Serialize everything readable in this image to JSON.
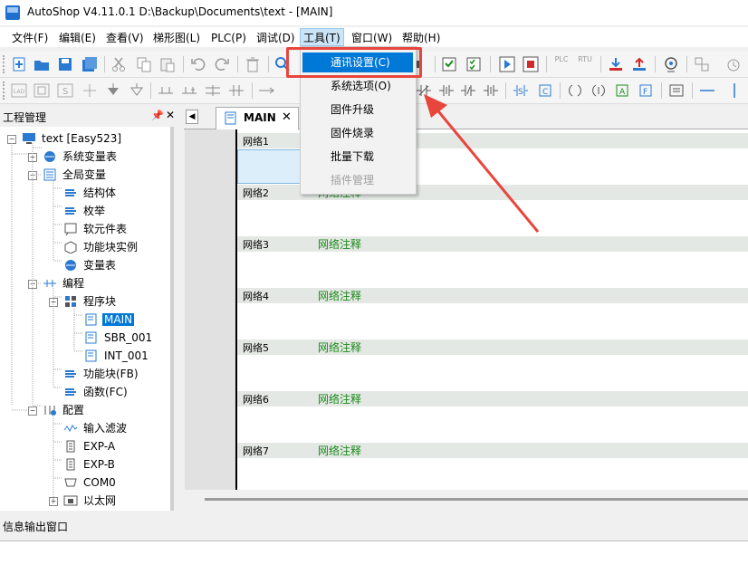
{
  "window": {
    "title": "AutoShop V4.11.0.1  D:\\Backup\\Documents\\text - [MAIN]"
  },
  "menubar": [
    {
      "label": "文件(F)"
    },
    {
      "label": "编辑(E)"
    },
    {
      "label": "查看(V)"
    },
    {
      "label": "梯形图(L)"
    },
    {
      "label": "PLC(P)"
    },
    {
      "label": "调试(D)"
    },
    {
      "label": "工具(T)"
    },
    {
      "label": "窗口(W)"
    },
    {
      "label": "帮助(H)"
    }
  ],
  "tools_menu": {
    "items": [
      {
        "label": "通讯设置(C)",
        "highlighted": true
      },
      {
        "label": "系统选项(O)"
      },
      {
        "label": "固件升级"
      },
      {
        "label": "固件烧录"
      },
      {
        "label": "批量下载"
      },
      {
        "label": "插件管理",
        "disabled": true
      }
    ]
  },
  "toolbar": {
    "plc_label": "PLC",
    "rtu_label": "RTU"
  },
  "project_pane": {
    "title": "工程管理",
    "pin_icon": "pin-icon",
    "tree": [
      {
        "label": "text [Easy523]"
      },
      {
        "label": "系统变量表"
      },
      {
        "label": "全局变量"
      },
      {
        "label": "结构体"
      },
      {
        "label": "枚举"
      },
      {
        "label": "软元件表"
      },
      {
        "label": "功能块实例"
      },
      {
        "label": "变量表"
      },
      {
        "label": "编程"
      },
      {
        "label": "程序块"
      },
      {
        "label": "MAIN"
      },
      {
        "label": "SBR_001"
      },
      {
        "label": "INT_001"
      },
      {
        "label": "功能块(FB)"
      },
      {
        "label": "函数(FC)"
      },
      {
        "label": "配置"
      },
      {
        "label": "输入滤波"
      },
      {
        "label": "EXP-A"
      },
      {
        "label": "EXP-B"
      },
      {
        "label": "COM0"
      },
      {
        "label": "以太网"
      }
    ]
  },
  "editor": {
    "tab": "MAIN",
    "networks": [
      {
        "label": "网络1",
        "comment": ""
      },
      {
        "label": "网络2",
        "comment": "网络注释"
      },
      {
        "label": "网络3",
        "comment": "网络注释"
      },
      {
        "label": "网络4",
        "comment": "网络注释"
      },
      {
        "label": "网络5",
        "comment": "网络注释"
      },
      {
        "label": "网络6",
        "comment": "网络注释"
      },
      {
        "label": "网络7",
        "comment": "网络注释"
      }
    ]
  },
  "info_pane": {
    "title": "信息输出窗口"
  },
  "colors": {
    "accent": "#0078d7",
    "annotation": "#e8453c",
    "comment": "#1a8a1a"
  }
}
